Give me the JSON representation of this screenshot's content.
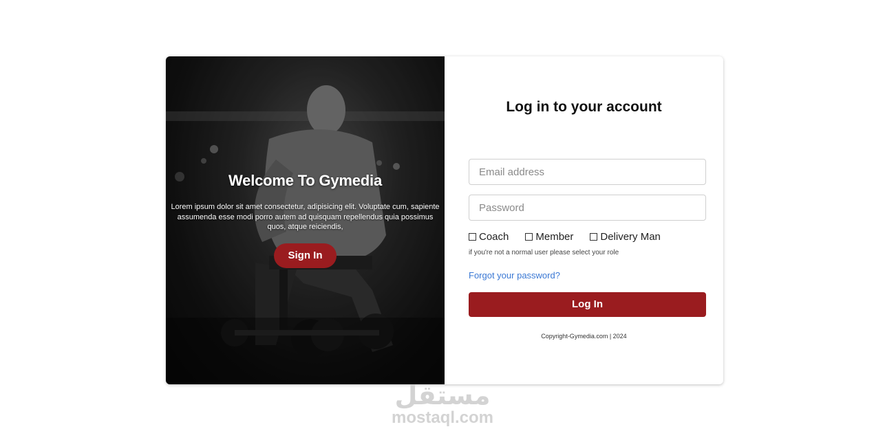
{
  "hero": {
    "title": "Welcome To Gymedia",
    "description": "Lorem ipsum dolor sit amet consectetur, adipisicing elit. Voluptate cum, sapiente assumenda esse modi porro autem ad quisquam repellendus quia possimus quos, atque reiciendis,",
    "sign_in_label": "Sign In"
  },
  "login": {
    "title": "Log in to your account",
    "email_placeholder": "Email address",
    "password_placeholder": "Password",
    "roles": [
      "Coach",
      "Member",
      "Delivery Man"
    ],
    "role_hint": "if you're not a normal user please select your role",
    "forgot_label": "Forgot your password?",
    "submit_label": "Log In",
    "copyright": "Copyright-Gymedia.com | 2024"
  },
  "watermark": {
    "arabic": "مستقل",
    "latin": "mostaql.com"
  },
  "colors": {
    "accent": "#9a1c1f",
    "link": "#3a78d4"
  }
}
